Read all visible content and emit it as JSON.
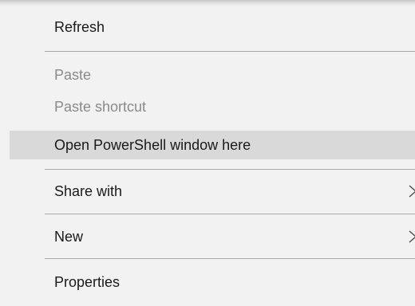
{
  "context_menu": {
    "items": [
      {
        "label": "Refresh",
        "enabled": true
      },
      {
        "label": "Paste",
        "enabled": false
      },
      {
        "label": "Paste shortcut",
        "enabled": false
      },
      {
        "label": "Open PowerShell window here",
        "enabled": true,
        "highlighted": true
      },
      {
        "label": "Share with",
        "enabled": true,
        "submenu": true,
        "icon": "chevron-right-icon"
      },
      {
        "label": "New",
        "enabled": true,
        "submenu": true,
        "icon": "chevron-right-icon"
      },
      {
        "label": "Properties",
        "enabled": true
      }
    ],
    "colors": {
      "background": "#f2f2f2",
      "highlight": "#d9d9d9",
      "text": "#1a1a1a",
      "disabled_text": "#8a8a8a",
      "separator": "#a8a8a8"
    }
  }
}
